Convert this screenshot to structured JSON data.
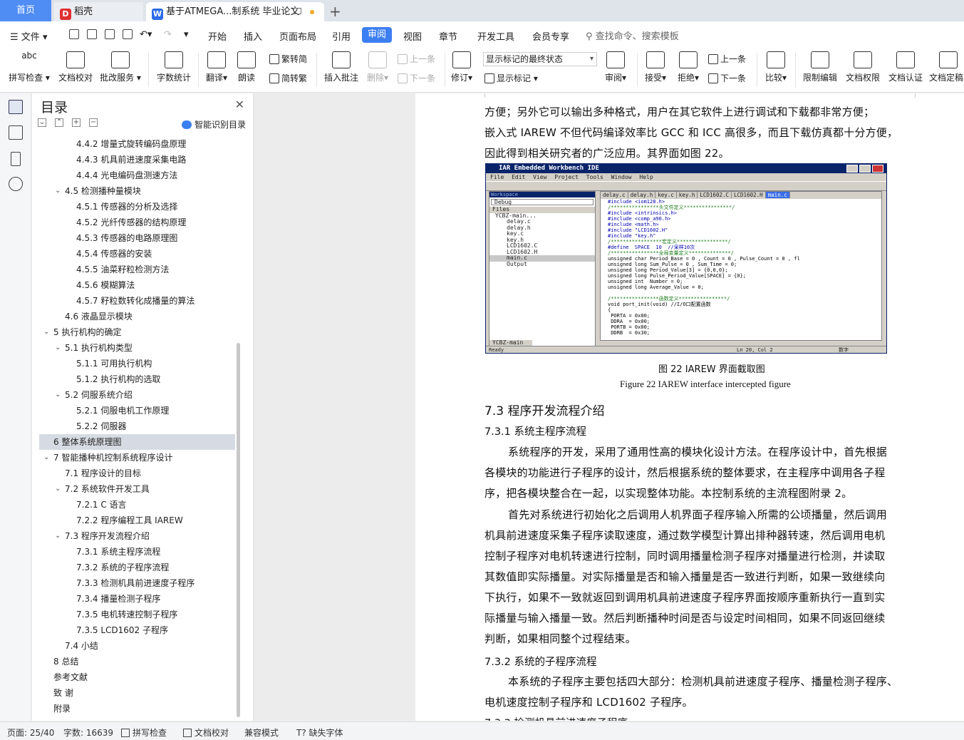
{
  "tabs": {
    "home": "首页",
    "daoke": "稻壳",
    "doc": "基于ATMEGA...制系统 毕业论文",
    "add": "+"
  },
  "menubar": {
    "file": "文件",
    "items": [
      "开始",
      "插入",
      "页面布局",
      "引用",
      "审阅",
      "视图",
      "章节",
      "开发工具",
      "会员专享"
    ],
    "active": "审阅",
    "search": "查找命令、搜索模板"
  },
  "ribbon": {
    "spell": "拼写检查",
    "spell_icon_text": "abc",
    "proof": "文档校对",
    "batch": "批改服务",
    "wordcount": "字数统计",
    "translate": "翻译",
    "read": "朗读",
    "trad": "繁转简",
    "simp": "简转繁",
    "insert_comment": "插入批注",
    "delete": "删除",
    "prev": "上一条",
    "next": "下一条",
    "revise": "修订",
    "markup_dropdown": "显示标记的最终状态",
    "show_markup": "显示标记",
    "review": "审阅",
    "accept": "接受",
    "reject": "拒绝",
    "prev2": "上一条",
    "next2": "下一条",
    "compare": "比较",
    "restrict": "限制编辑",
    "permission": "文档权限",
    "certify": "文档认证",
    "finalize": "文档定稿"
  },
  "toc": {
    "title": "目录",
    "smart": "智能识别目录",
    "items": [
      {
        "label": "4.4.2   增量式旋转编码盘原理",
        "level": 3
      },
      {
        "label": "4.4.3  机具前进速度采集电路",
        "level": 3
      },
      {
        "label": "4.4.4  光电编码盘测速方法",
        "level": 3
      },
      {
        "label": "4.5  检测播种量模块",
        "level": 2,
        "expand": true
      },
      {
        "label": "4.5.1  传感器的分析及选择",
        "level": 3
      },
      {
        "label": "4.5.2  光纤传感器的结构原理",
        "level": 3
      },
      {
        "label": "4.5.3  传感器的电路原理图",
        "level": 3
      },
      {
        "label": "4.5.4  传感器的安装",
        "level": 3
      },
      {
        "label": "4.5.5  油菜籽粒检测方法",
        "level": 3
      },
      {
        "label": "4.5.6  模糊算法",
        "level": 3
      },
      {
        "label": "4.5.7  籽粒数转化成播量的算法",
        "level": 3
      },
      {
        "label": "4.6  液晶显示模块",
        "level": 2
      },
      {
        "label": "5  执行机构的确定",
        "level": 1,
        "expand": true
      },
      {
        "label": "5.1 执行机构类型",
        "level": 2,
        "expand": true
      },
      {
        "label": "5.1.1 可用执行机构",
        "level": 3
      },
      {
        "label": "5.1.2  执行机构的选取",
        "level": 3
      },
      {
        "label": "5.2  伺服系统介绍",
        "level": 2,
        "expand": true
      },
      {
        "label": "5.2.1  伺服电机工作原理",
        "level": 3
      },
      {
        "label": "5.2.2 伺服器",
        "level": 3
      },
      {
        "label": "6  整体系统原理图",
        "level": 1,
        "selected": true
      },
      {
        "label": "7  智能播种机控制系统程序设计",
        "level": 1,
        "expand": true
      },
      {
        "label": "7.1  程序设计的目标",
        "level": 2
      },
      {
        "label": "7.2  系统软件开发工具",
        "level": 2,
        "expand": true
      },
      {
        "label": "7.2.1 C 语言",
        "level": 3
      },
      {
        "label": "7.2.2  程序编程工具 IAREW",
        "level": 3
      },
      {
        "label": "7.3  程序开发流程介绍",
        "level": 2,
        "expand": true
      },
      {
        "label": "7.3.1  系统主程序流程",
        "level": 3
      },
      {
        "label": "7.3.2  系统的子程序流程",
        "level": 3
      },
      {
        "label": "7.3.3  检测机具前进速度子程序",
        "level": 3
      },
      {
        "label": "7.3.4  播量检测子程序",
        "level": 3
      },
      {
        "label": "7.3.5  电机转速控制子程序",
        "level": 3
      },
      {
        "label": "7.3.5 LCD1602 子程序",
        "level": 3
      },
      {
        "label": "7.4  小结",
        "level": 2
      },
      {
        "label": "8  总结",
        "level": 1
      },
      {
        "label": "参考文献",
        "level": 1
      },
      {
        "label": "致    谢",
        "level": 1
      },
      {
        "label": "附录",
        "level": 1
      }
    ]
  },
  "document": {
    "lines_top": [
      "方便；另外它可以输出多种格式，用户在其它软件上进行调试和下载都非常方便；",
      "嵌入式 IAREW 不但代码编译效率比 GCC 和 ICC 高很多，而且下载仿真都十分方便，",
      "因此得到相关研究者的广泛应用。其界面如图 22。"
    ],
    "figure_caption_cn": "图 22    IAREW 界面截取图",
    "figure_caption_en": "Figure 22    IAREW interface intercepted figure",
    "h_7_3": "7.3  程序开发流程介绍",
    "h_7_3_1": "7.3.1  系统主程序流程",
    "para1": [
      "系统程序的开发，采用了通用性高的模块化设计方法。在程序设计中，首先根据",
      "各模块的功能进行子程序的设计，然后根据系统的整体要求，在主程序中调用各子程",
      "序，把各模块整合在一起，以实现整体功能。本控制系统的主流程图附录 2。"
    ],
    "para2": [
      "首先对系统进行初始化之后调用人机界面子程序输入所需的公顷播量，然后调用",
      "机具前进速度采集子程序读取速度，通过数学模型计算出排种器转速，然后调用电机",
      "控制子程序对电机转速进行控制，同时调用播量检测子程序对播量进行检测，并读取",
      "其数值即实际播量。对实际播量是否和输入播量是否一致进行判断，如果一致继续向",
      "下执行，如果不一致就返回到调用机具前进速度子程序界面按顺序重新执行一直到实",
      "际播量与输入播量一致。然后判断播种时间是否与设定时间相同，如果不同返回继续",
      "判断，如果相同整个过程结束。"
    ],
    "h_7_3_2": "7.3.2  系统的子程序流程",
    "para3": [
      "本系统的子程序主要包括四大部分：检测机具前进速度子程序、播量检测子程序、",
      "电机速度控制子程序和 LCD1602 子程序。"
    ],
    "h_7_3_3_partial": "7.3.3  检测机具前进速度子程序"
  },
  "ide": {
    "title": "IAR Embedded Workbench IDE",
    "menu": "File Edit View Project Tools Window Help",
    "workspace_label": "Workspace",
    "config": "Debug",
    "files_header": "Files",
    "files": [
      "YCBZ-main...",
      "delay.c",
      "delay.h",
      "key.c",
      "key.h",
      "LCD1602.C",
      "LCD1602.H",
      "main.c",
      "Output"
    ],
    "ws_tab": "YCBZ-main",
    "tabs": [
      "delay.c",
      "delay.h",
      "key.c",
      "key.h",
      "LCD1602.C",
      "LCD1602.H",
      "main.c"
    ],
    "code": [
      {
        "t": "#include <iom128.h>",
        "k": "k"
      },
      {
        "t": "/****************头文件定义****************/",
        "k": "c"
      },
      {
        "t": "#include <intrinsics.h>",
        "k": "k"
      },
      {
        "t": "#include <comp_a90.h>",
        "k": "k"
      },
      {
        "t": "#include <math.h>",
        "k": "k"
      },
      {
        "t": "#include \"LCD1602.H\"",
        "k": "k"
      },
      {
        "t": "#include \"key.h\"",
        "k": "k"
      },
      {
        "t": "/*****************宏定义*****************/",
        "k": "c"
      },
      {
        "t": "#define  SPACE  10  //采样10次",
        "k": "k"
      },
      {
        "t": "/****************全局变量定义**************/",
        "k": "c"
      },
      {
        "t": "unsigned char Period_Base = 0 , Count = 0 , Pulse_Count = 0 , fl",
        "k": ""
      },
      {
        "t": "unsigned long Sum_Pulse = 0 , Sum_Time = 0;",
        "k": ""
      },
      {
        "t": "unsigned long Period_Value[3] = {0,0,0};",
        "k": ""
      },
      {
        "t": "unsigned long Pulse_Period_Value[SPACE] = {0};",
        "k": ""
      },
      {
        "t": "unsigned int  Number = 0;",
        "k": ""
      },
      {
        "t": "unsigned long Average_Value = 0;",
        "k": ""
      },
      {
        "t": "",
        "k": ""
      },
      {
        "t": "/****************函数定义****************/",
        "k": "c"
      },
      {
        "t": "void port_init(void) //I/O口配置函数",
        "k": ""
      },
      {
        "t": "{",
        "k": ""
      },
      {
        "t": " PORTA = 0x00;",
        "k": ""
      },
      {
        "t": " DDRA  = 0x00;",
        "k": ""
      },
      {
        "t": " PORTB = 0x00;",
        "k": ""
      },
      {
        "t": " DDRB  = 0x30;",
        "k": ""
      }
    ],
    "status_left": "Ready",
    "status_pos": "Ln 20, Col 2",
    "status_right": "数字"
  },
  "status": {
    "page": "页面: 25/40",
    "words": "字数: 16639",
    "spell": "拼写检查",
    "proof": "文档校对",
    "compat": "兼容模式",
    "missing_font": "缺失字体"
  },
  "colors": {
    "accent": "#3c7ff2",
    "home_tab": "#4f8df5",
    "ide_title": "#0a246a"
  }
}
